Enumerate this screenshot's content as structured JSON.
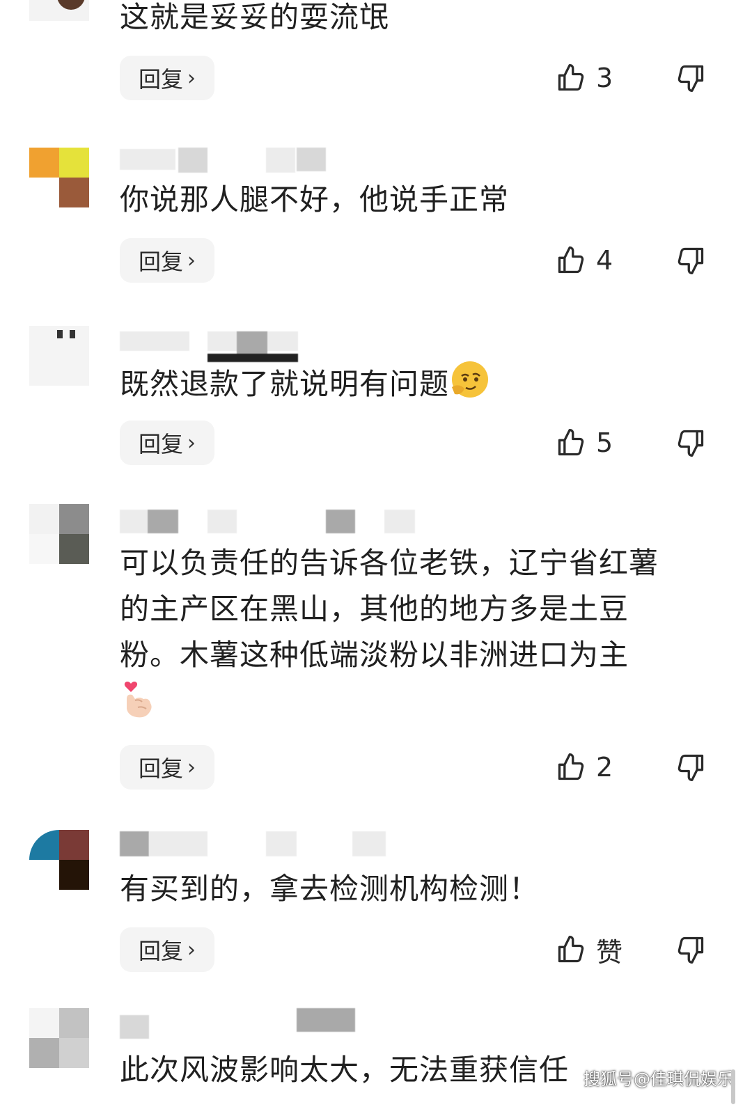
{
  "colors": {
    "text": "#202020",
    "reply_bg": "#f4f4f4",
    "icon": "#2a2a2a"
  },
  "comments": [
    {
      "text": "这就是妥妥的耍流氓",
      "reply_label": "回复",
      "likes": "3"
    },
    {
      "text": "你说那人腿不好，他说手正常",
      "reply_label": "回复",
      "likes": "4"
    },
    {
      "text": "既然退款了就说明有问题",
      "emoji": "thinking-face-emoji",
      "reply_label": "回复",
      "likes": "5"
    },
    {
      "text_lines": [
        "可以负责任的告诉各位老铁，辽宁省红薯",
        "的主产区在黑山，其他的地方多是土豆",
        "粉。木薯这种低端淡粉以非洲进口为主"
      ],
      "emoji": "finger-heart-emoji",
      "reply_label": "回复",
      "likes": "2"
    },
    {
      "text": "有买到的，拿去检测机构检测！",
      "reply_label": "回复",
      "likes": "赞"
    },
    {
      "text": "此次风波影响太大，无法重获信任"
    }
  ],
  "watermark": "搜狐号@佳琪侃娱乐",
  "icons": {
    "like": "thumbs-up-icon",
    "dislike": "thumbs-down-icon",
    "reply_chevron": "chevron-right-icon"
  }
}
